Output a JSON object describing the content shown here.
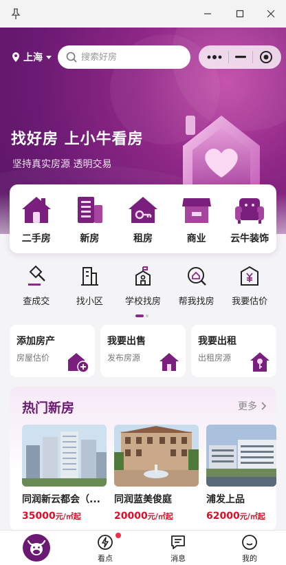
{
  "window": {
    "controls": [
      "pin-icon",
      "minimize-icon",
      "maximize-icon",
      "close-icon"
    ]
  },
  "header": {
    "city": "上海",
    "search_placeholder": "搜索好房",
    "capsule_icons": [
      "more-icon",
      "minimize-icon",
      "target-icon"
    ]
  },
  "hero": {
    "title": "找好房 上小牛看房",
    "subtitle": "坚持真实房源 透明交易"
  },
  "main_categories": [
    {
      "label": "二手房",
      "icon": "second-hand-house-icon"
    },
    {
      "label": "新房",
      "icon": "new-house-icon"
    },
    {
      "label": "租房",
      "icon": "rent-house-icon"
    },
    {
      "label": "商业",
      "icon": "shop-icon"
    },
    {
      "label": "云牛装饰",
      "icon": "sofa-icon"
    }
  ],
  "sub_categories": [
    {
      "label": "查成交",
      "icon": "gavel-icon"
    },
    {
      "label": "找小区",
      "icon": "building-icon"
    },
    {
      "label": "学校找房",
      "icon": "school-icon"
    },
    {
      "label": "帮我找房",
      "icon": "search-house-icon"
    },
    {
      "label": "我要估价",
      "icon": "price-tag-icon"
    }
  ],
  "quick_actions": [
    {
      "title": "添加房产",
      "subtitle": "房屋估价",
      "icon": "add-house-icon"
    },
    {
      "title": "我要出售",
      "subtitle": "发布房源",
      "icon": "sell-house-icon"
    },
    {
      "title": "我要出租",
      "subtitle": "出租房源",
      "icon": "key-icon"
    }
  ],
  "hot_new_homes": {
    "title": "热门新房",
    "more_label": "更多",
    "items": [
      {
        "name": "同润新云都会（...",
        "price": "35000",
        "unit": "元/㎡起"
      },
      {
        "name": "同润蓝美俊庭",
        "price": "20000",
        "unit": "元/㎡起"
      },
      {
        "name": "浦发上品",
        "price": "62000",
        "unit": "元/㎡起"
      }
    ]
  },
  "tabbar": {
    "items": [
      {
        "label": "",
        "icon": "home-bull-icon"
      },
      {
        "label": "看点",
        "icon": "lightning-icon",
        "badge": true
      },
      {
        "label": "消息",
        "icon": "message-icon"
      },
      {
        "label": "我的",
        "icon": "smile-icon"
      }
    ]
  },
  "colors": {
    "brand": "#6b1a73",
    "accent": "#8e2786",
    "price": "#d7102a"
  }
}
